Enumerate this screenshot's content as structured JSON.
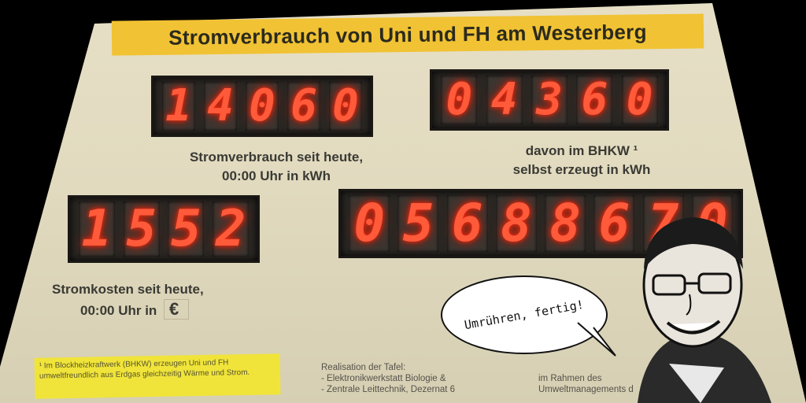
{
  "title": "Stromverbrauch von Uni und FH am Westerberg",
  "displays": {
    "consumption_today": "14060",
    "bhkw_generated": "04360",
    "cost_today": "1552",
    "total_counter": "05688670"
  },
  "captions": {
    "consumption": [
      "Stromverbrauch seit heute,",
      "00:00 Uhr in kWh"
    ],
    "bhkw": [
      "davon im BHKW ¹",
      "selbst erzeugt in kWh"
    ],
    "cost": [
      "Stromkosten seit heute,",
      "00:00 Uhr in"
    ],
    "currency_symbol": "€"
  },
  "footnote": "¹ Im Blockheizkraftwerk (BHKW) erzeugen Uni und FH umweltfreundlich aus Erdgas gleichzeitig Wärme und Strom.",
  "realisation": [
    "Realisation der Tafel:",
    "- Elektronikwerkstatt Biologie &",
    "- Zentrale Leittechnik, Dezernat 6"
  ],
  "environment_note": [
    "im Rahmen des",
    "Umweltmanagements d"
  ],
  "speech_bubble": "Umrühren, fertig!",
  "colors": {
    "board": "#e2dbc0",
    "title_strip": "#f1c233",
    "led_digit": "#ff5a3a",
    "footnote_bg": "#f0e43a"
  }
}
